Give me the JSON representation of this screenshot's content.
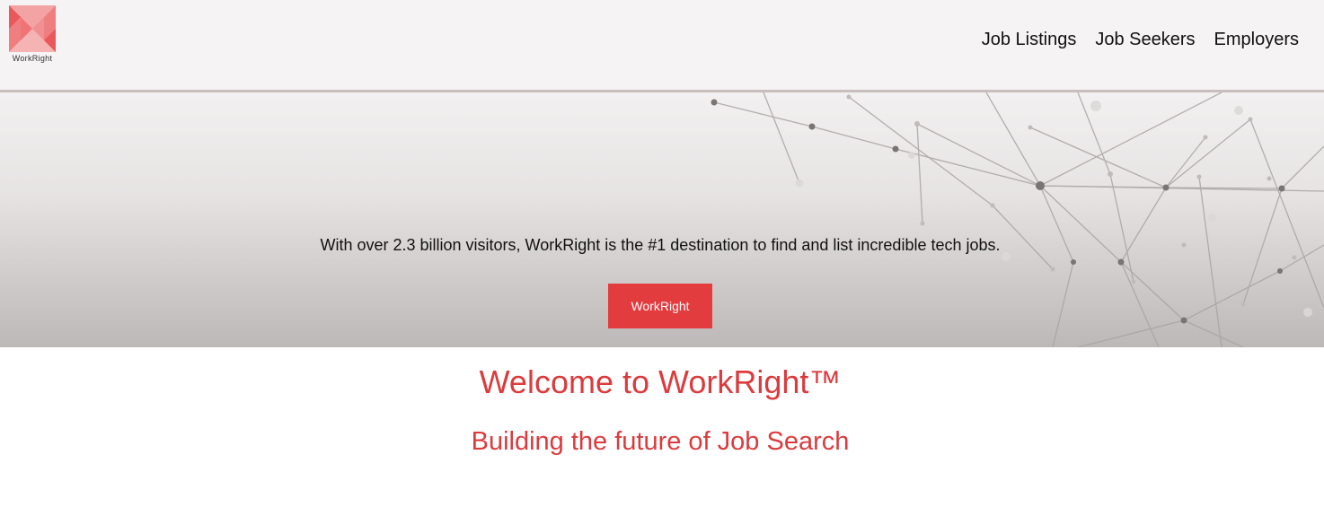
{
  "brand": {
    "logo_text": "WorkRight",
    "accent_color": "#e33c3f"
  },
  "nav": {
    "items": [
      {
        "label": "Job Listings"
      },
      {
        "label": "Job Seekers"
      },
      {
        "label": "Employers"
      }
    ]
  },
  "hero": {
    "tagline": "With over 2.3 billion visitors, WorkRight is the #1 destination to find and list incredible tech jobs.",
    "button_label": "WorkRight"
  },
  "welcome": {
    "title": "Welcome to WorkRight™",
    "subtitle": "Building the future of Job Search"
  }
}
